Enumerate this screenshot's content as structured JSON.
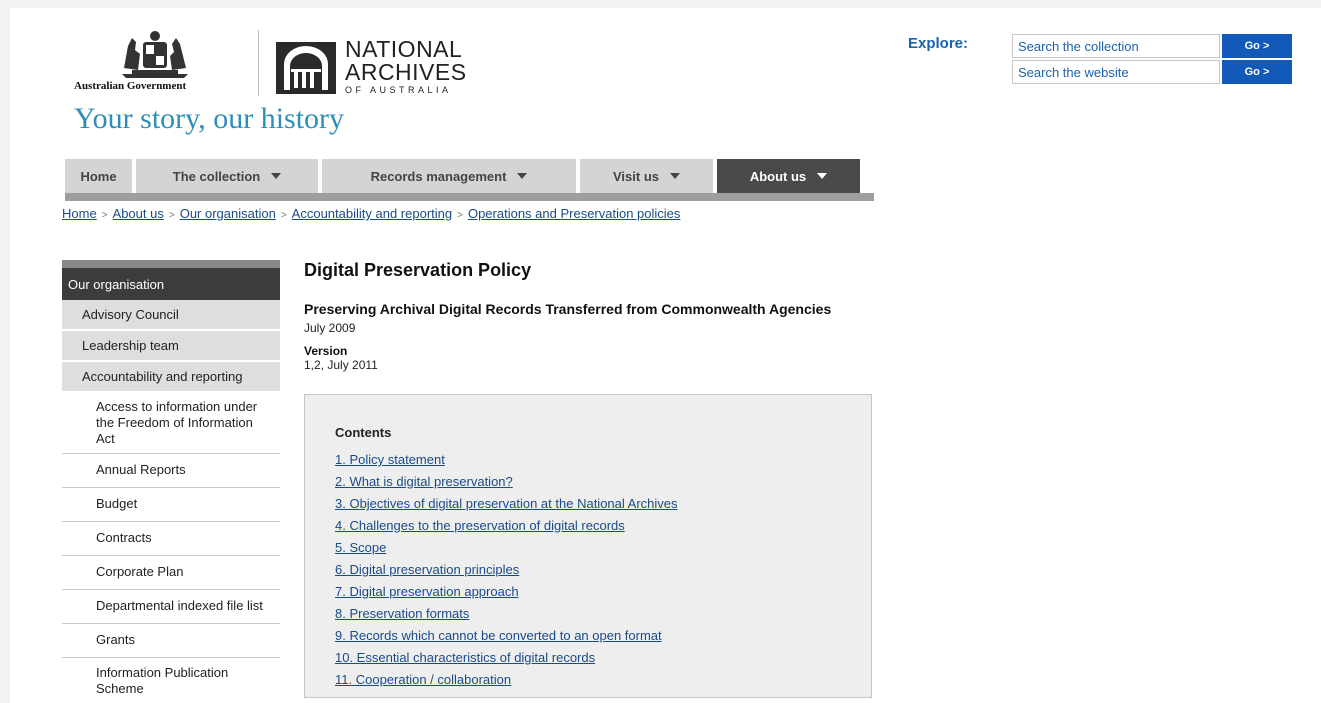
{
  "header": {
    "gov_name": "Australian Government",
    "naa_line1": "NATIONAL",
    "naa_line2": "ARCHIVES",
    "naa_line3": "OF AUSTRALIA",
    "tagline": "Your story, our history",
    "explore_label": "Explore:",
    "search_collection_placeholder": "Search the collection",
    "search_website_placeholder": "Search the website",
    "go_label": "Go >"
  },
  "nav": [
    {
      "label": "Home",
      "has_caret": false,
      "active": false
    },
    {
      "label": "The collection",
      "has_caret": true,
      "active": false
    },
    {
      "label": "Records management",
      "has_caret": true,
      "active": false
    },
    {
      "label": "Visit us",
      "has_caret": true,
      "active": false
    },
    {
      "label": "About us",
      "has_caret": true,
      "active": true
    }
  ],
  "breadcrumb": [
    "Home",
    "About us",
    "Our organisation",
    "Accountability and reporting",
    "Operations and Preservation policies"
  ],
  "sidebar": {
    "heading": "Our organisation",
    "level1": [
      "Advisory Council",
      "Leadership team",
      "Accountability and reporting"
    ],
    "level2": [
      "Access to information under the Freedom of Information Act",
      "Annual Reports",
      "Budget",
      "Contracts",
      "Corporate Plan",
      "Departmental indexed file list",
      "Grants",
      "Information Publication Scheme"
    ]
  },
  "main": {
    "title": "Digital Preservation Policy",
    "subtitle": "Preserving Archival Digital Records Transferred from Commonwealth Agencies",
    "date": "July 2009",
    "version_label": "Version",
    "version_value": "1,2, July 2011",
    "contents_title": "Contents",
    "contents": [
      "1. Policy statement",
      "2. What is digital preservation?",
      "3. Objectives of digital preservation at the National Archives",
      "4. Challenges to the preservation of digital records",
      "5. Scope",
      "6. Digital preservation principles",
      "7. Digital preservation approach",
      "8. Preservation formats",
      "9. Records which cannot be converted to an open format",
      "10. Essential characteristics of digital records",
      "11. Cooperation / collaboration"
    ]
  },
  "colors": {
    "link": "#1a4a8a",
    "tagline": "#2e8fb6",
    "go_button": "#1259b8",
    "nav_active": "#4a4a4a",
    "nav_inactive": "#d4d4d4"
  }
}
